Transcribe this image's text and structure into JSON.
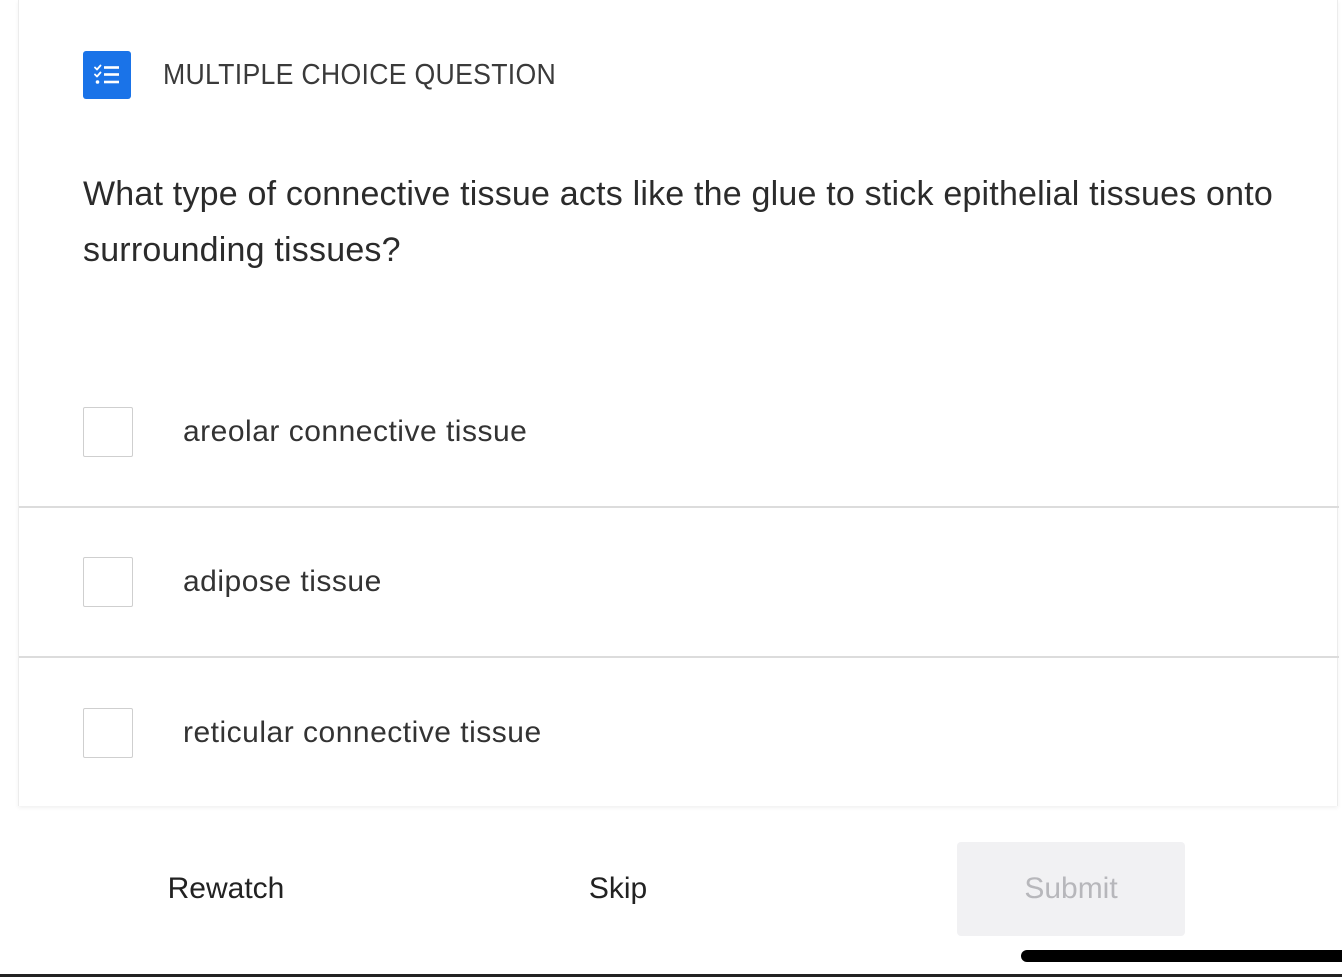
{
  "header": {
    "icon": "checklist-icon",
    "type_label": "MULTIPLE CHOICE QUESTION",
    "accent_color": "#1a73e8"
  },
  "question": {
    "text": "What type of connective tissue acts like the glue to stick epithelial tissues onto surrounding tissues?"
  },
  "options": [
    {
      "label": "areolar connective tissue",
      "checked": false
    },
    {
      "label": "adipose tissue",
      "checked": false
    },
    {
      "label": "reticular connective tissue",
      "checked": false
    }
  ],
  "footer": {
    "rewatch_label": "Rewatch",
    "skip_label": "Skip",
    "submit_label": "Submit",
    "submit_disabled": true
  }
}
